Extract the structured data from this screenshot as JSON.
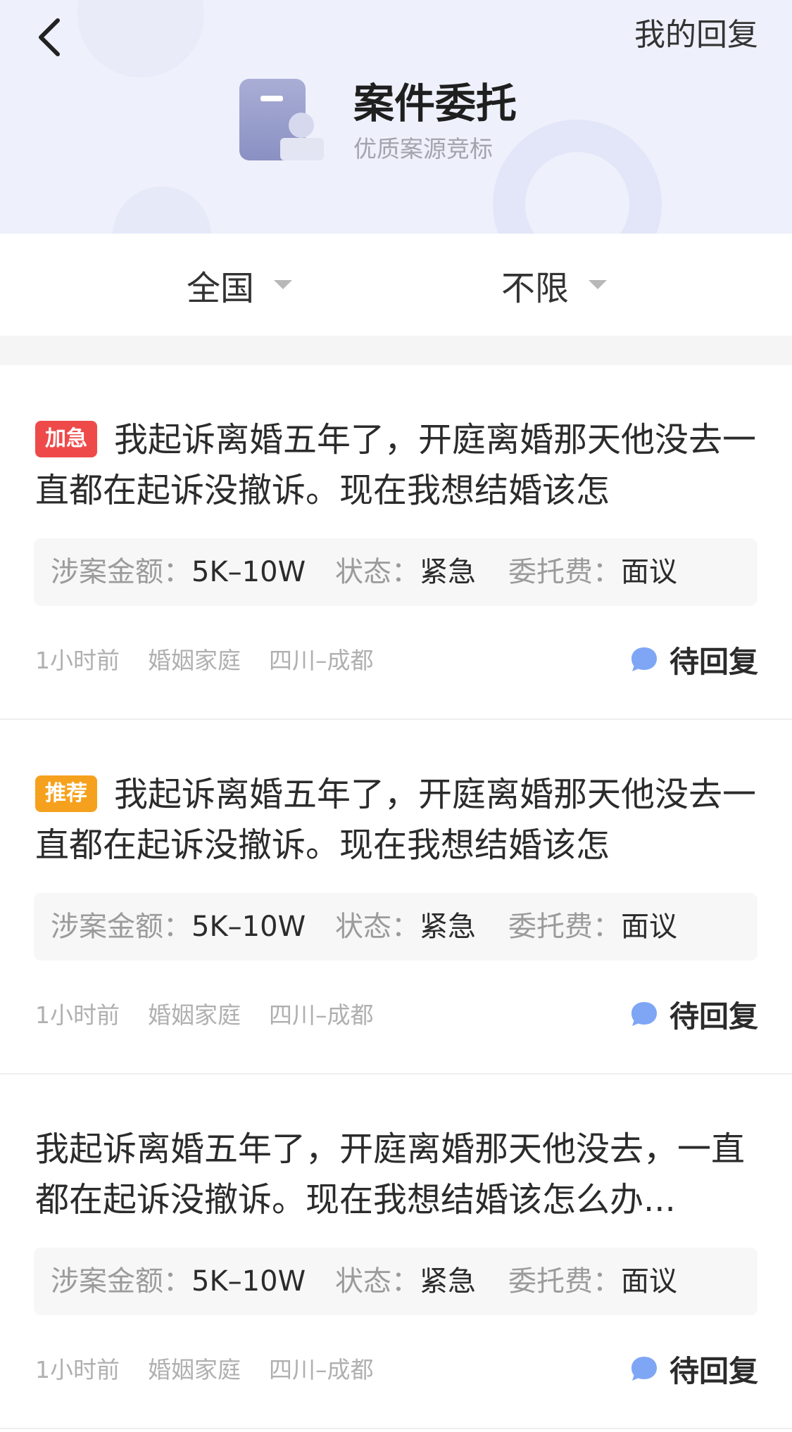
{
  "header": {
    "my_reply_label": "我的回复",
    "title": "案件委托",
    "subtitle": "优质案源竞标"
  },
  "filters": [
    {
      "label": "全国"
    },
    {
      "label": "不限"
    }
  ],
  "info_labels": {
    "amount": "涉案金额：",
    "status": "状态：",
    "fee": "委托费："
  },
  "cases": [
    {
      "badge": "加急",
      "badge_color": "#ef4a4a",
      "title": "我起诉离婚五年了，开庭离婚那天他没去一直都在起诉没撤诉。现在我想结婚该怎",
      "amount": "5K–10W",
      "status": "紧急",
      "fee": "面议",
      "time": "1小时前",
      "category": "婚姻家庭",
      "location": "四川–成都",
      "reply_status": "待回复"
    },
    {
      "badge": "推荐",
      "badge_color": "#f6a11e",
      "title": "我起诉离婚五年了，开庭离婚那天他没去一直都在起诉没撤诉。现在我想结婚该怎",
      "amount": "5K–10W",
      "status": "紧急",
      "fee": "面议",
      "time": "1小时前",
      "category": "婚姻家庭",
      "location": "四川–成都",
      "reply_status": "待回复"
    },
    {
      "badge": "",
      "title": "我起诉离婚五年了，开庭离婚那天他没去，一直都在起诉没撤诉。现在我想结婚该怎么办...",
      "amount": "5K–10W",
      "status": "紧急",
      "fee": "面议",
      "time": "1小时前",
      "category": "婚姻家庭",
      "location": "四川–成都",
      "reply_status": "待回复"
    }
  ],
  "colors": {
    "accent_blue": "#7fa6f5",
    "hero_bg": "#eef0fb"
  }
}
